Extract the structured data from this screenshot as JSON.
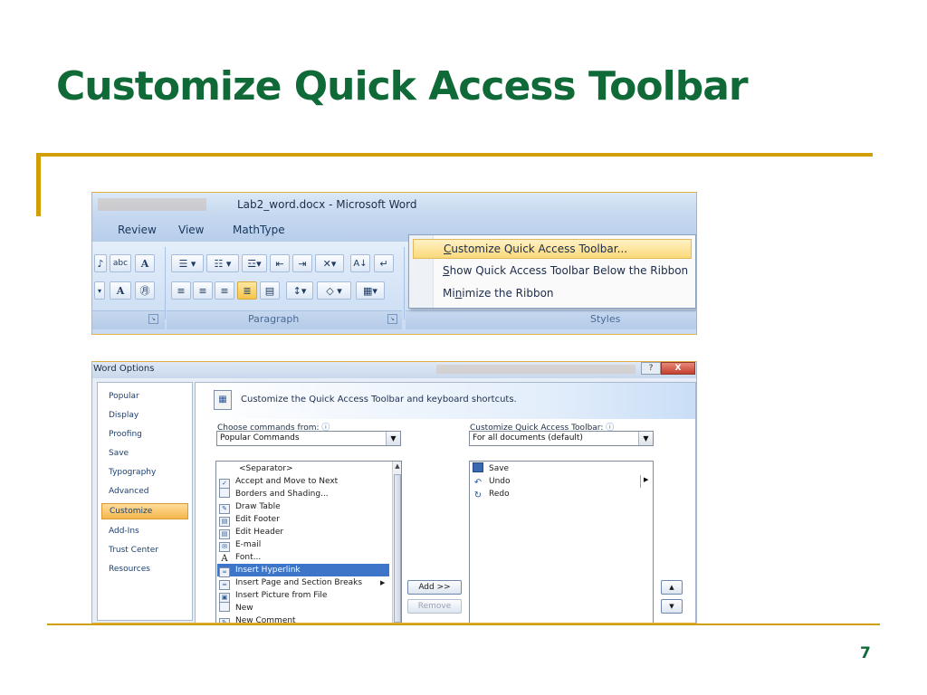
{
  "slide": {
    "title": "Customize Quick Access Toolbar",
    "page_number": "7",
    "accent_color": "#d29e08",
    "title_color": "#0f6a37"
  },
  "word_ribbon": {
    "window_title": "Lab2_word.docx - Microsoft Word",
    "tabs": [
      "Review",
      "View",
      "MathType"
    ],
    "groups": [
      "Paragraph",
      "Styles"
    ],
    "toolbar_button_glyphs": [
      "abc",
      "A",
      "A"
    ],
    "menu": {
      "items": [
        {
          "prefix": "",
          "mnemonic": "C",
          "rest": "ustomize Quick Access Toolbar...",
          "highlighted": true
        },
        {
          "prefix": "",
          "mnemonic": "S",
          "rest": "how Quick Access Toolbar Below the Ribbon",
          "highlighted": false
        },
        {
          "prefix": "Mi",
          "mnemonic": "n",
          "rest": "imize the Ribbon",
          "highlighted": false
        }
      ]
    }
  },
  "word_options": {
    "window_title": "Word Options",
    "help_glyph": "?",
    "close_glyph": "X",
    "nav_items": [
      "Popular",
      "Display",
      "Proofing",
      "Save",
      "Typography",
      "Advanced",
      "Customize",
      "Add-Ins",
      "Trust Center",
      "Resources"
    ],
    "selected_nav": "Customize",
    "banner_text": "Customize the Quick Access Toolbar and keyboard shortcuts.",
    "choose_label": "Choose commands from:",
    "choose_value": "Popular Commands",
    "customize_label": "Customize Quick Access Toolbar:",
    "customize_value": "For all documents (default)",
    "commands": [
      {
        "label": "<Separator>",
        "icon": "none"
      },
      {
        "label": "Accept and Move to Next",
        "icon": "accept-icon"
      },
      {
        "label": "Borders and Shading...",
        "icon": "page-icon"
      },
      {
        "label": "Draw Table",
        "icon": "draw-table-icon"
      },
      {
        "label": "Edit Footer",
        "icon": "footer-icon"
      },
      {
        "label": "Edit Header",
        "icon": "header-icon"
      },
      {
        "label": "E-mail",
        "icon": "email-icon"
      },
      {
        "label": "Font...",
        "icon": "font-icon"
      },
      {
        "label": "Insert Hyperlink",
        "icon": "hyperlink-icon",
        "selected": true
      },
      {
        "label": "Insert Page and Section Breaks",
        "icon": "page-break-icon",
        "submenu": true
      },
      {
        "label": "Insert Picture from File",
        "icon": "picture-icon"
      },
      {
        "label": "New",
        "icon": "new-document-icon"
      },
      {
        "label": "New Comment",
        "icon": "comment-icon"
      }
    ],
    "qat_items": [
      {
        "label": "Save",
        "icon": "save-icon"
      },
      {
        "label": "Undo",
        "icon": "undo-icon"
      },
      {
        "label": "Redo",
        "icon": "redo-icon"
      }
    ],
    "add_button": "Add >>",
    "remove_button": "Remove"
  }
}
